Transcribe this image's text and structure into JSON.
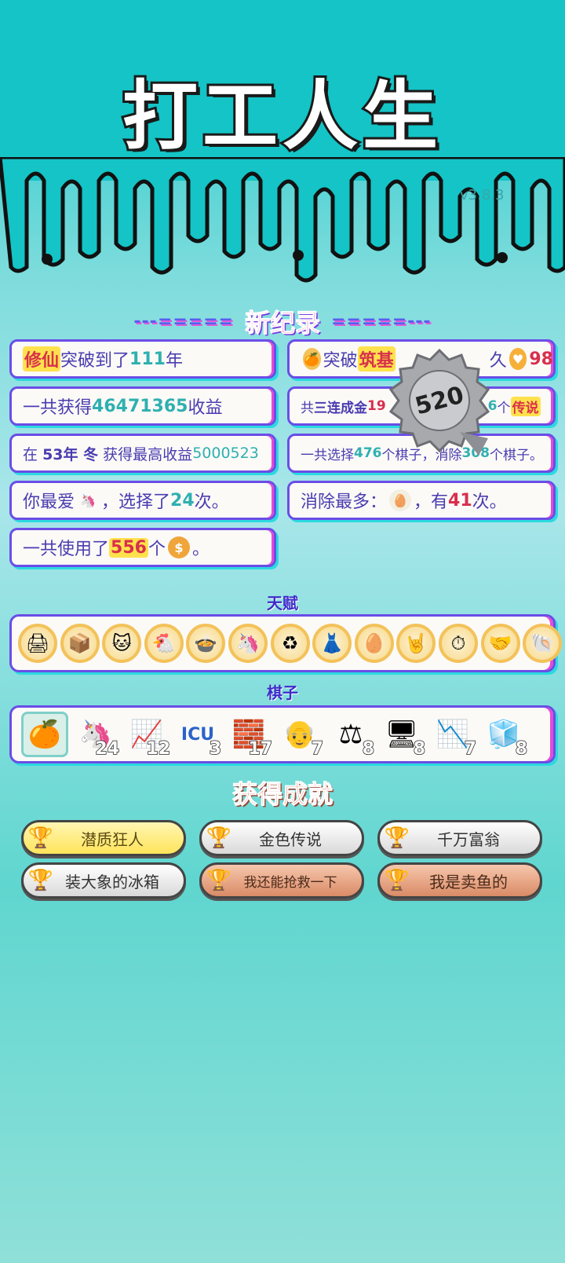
{
  "header": {
    "title": "打工人生",
    "version": "v3.8.3"
  },
  "new_record": {
    "deco_left": "---=====",
    "title": "新纪录",
    "deco_right": "=====---"
  },
  "records": {
    "r1": {
      "tag": "修仙",
      "text1": "突破到了",
      "num": "111",
      "text2": "年"
    },
    "r2": {
      "text1": "突破",
      "tag": "筑基",
      "text2": "久",
      "num": "98"
    },
    "r3": {
      "text1": "一共获得",
      "num": "46471365",
      "text2": "收益"
    },
    "r4": {
      "text1": "共",
      "bold": "三连成金",
      "num": "19",
      "num2": "6",
      "text2": "个",
      "tag": "传说"
    },
    "r5": {
      "text1": "在",
      "bold": "53年 冬",
      "text2": "获得最高收益",
      "num": "5000523"
    },
    "r6": {
      "text1": "一共选择",
      "num": "476",
      "text2": "个棋子，消除",
      "num2": "308",
      "text3": "个棋子。"
    },
    "r7": {
      "text1": "你最爱",
      "text2": "，选择了",
      "num": "24",
      "text3": "次。"
    },
    "r8": {
      "text1": "消除最多：",
      "text2": "，有",
      "num": "41",
      "text3": "次。"
    },
    "r9": {
      "text1": "一共使用了",
      "num": "556",
      "text2": "个",
      "text3": "。"
    }
  },
  "seal": {
    "value": "520"
  },
  "talents": {
    "label": "天赋",
    "icons": [
      "printer-icon",
      "box-icon",
      "cat-icon",
      "chicken-icon",
      "pot-icon",
      "unicorn-icon",
      "recycle-icon",
      "skirt-icon",
      "egg-icon",
      "rock-hand-icon",
      "time-card-icon",
      "handshake-icon",
      "shell-icon"
    ]
  },
  "pieces": {
    "label": "棋子",
    "items": [
      {
        "icon": "persimmon-icon",
        "count": ""
      },
      {
        "icon": "unicorn-icon",
        "count": "24"
      },
      {
        "icon": "chart-icon",
        "count": "12"
      },
      {
        "icon": "icu-icon",
        "count": "3"
      },
      {
        "icon": "gold-bars-icon",
        "count": "17"
      },
      {
        "icon": "old-man-icon",
        "count": "7"
      },
      {
        "icon": "scale-icon",
        "count": "8"
      },
      {
        "icon": "server-icon",
        "count": "8"
      },
      {
        "icon": "trend-icon",
        "count": "7"
      },
      {
        "icon": "fridge-icon",
        "count": "8"
      }
    ]
  },
  "achievements": {
    "title": "获得成就",
    "items": [
      {
        "label": "潜质狂人",
        "tier": "gold"
      },
      {
        "label": "金色传说",
        "tier": "silver"
      },
      {
        "label": "千万富翁",
        "tier": "silver"
      },
      {
        "label": "装大象的冰箱",
        "tier": "silver"
      },
      {
        "label": "我还能抢救一下",
        "tier": "bronze"
      },
      {
        "label": "我是卖鱼的",
        "tier": "bronze"
      }
    ]
  }
}
